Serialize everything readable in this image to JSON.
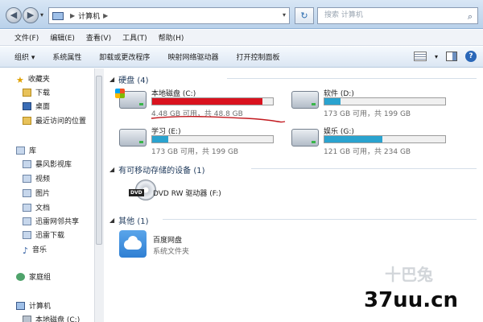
{
  "address": {
    "breadcrumb": "计算机",
    "search_placeholder": "搜索 计算机"
  },
  "menu": [
    "文件(F)",
    "编辑(E)",
    "查看(V)",
    "工具(T)",
    "帮助(H)"
  ],
  "commands": [
    "组织",
    "系统属性",
    "卸载或更改程序",
    "映射网络驱动器",
    "打开控制面板"
  ],
  "sidebar": {
    "favorites": "收藏夹",
    "fav_items": [
      "下载",
      "桌面",
      "最近访问的位置"
    ],
    "libraries": "库",
    "lib_items": [
      "暴风影视库",
      "视频",
      "图片",
      "文档",
      "迅雷网邻共享",
      "迅雷下载",
      "音乐"
    ],
    "homegroup": "家庭组",
    "computer": "计算机",
    "computer_items": [
      "本地磁盘 (C:)"
    ]
  },
  "groups": {
    "hdd": "硬盘 (4)",
    "removable": "有可移动存储的设备 (1)",
    "other": "其他 (1)"
  },
  "drives": [
    {
      "name": "本地磁盘 (C:)",
      "info": "4.48 GB 可用，共 48.8 GB",
      "used_fraction": 0.91,
      "color": "#d9121e"
    },
    {
      "name": "软件 (D:)",
      "info": "173 GB 可用，共 199 GB",
      "used_fraction": 0.13,
      "color": "#2aa3cf"
    },
    {
      "name": "学习 (E:)",
      "info": "173 GB 可用，共 199 GB",
      "used_fraction": 0.13,
      "color": "#2aa3cf"
    },
    {
      "name": "娱乐 (G:)",
      "info": "121 GB 可用，共 234 GB",
      "used_fraction": 0.48,
      "color": "#2aa3cf"
    }
  ],
  "dvd": {
    "name": "DVD RW 驱动器 (F:)",
    "badge": "DVD"
  },
  "other_item": {
    "name": "百度网盘",
    "type": "系统文件夹"
  },
  "watermark": {
    "text": "37uu.cn",
    "logo": "十巴兔"
  }
}
